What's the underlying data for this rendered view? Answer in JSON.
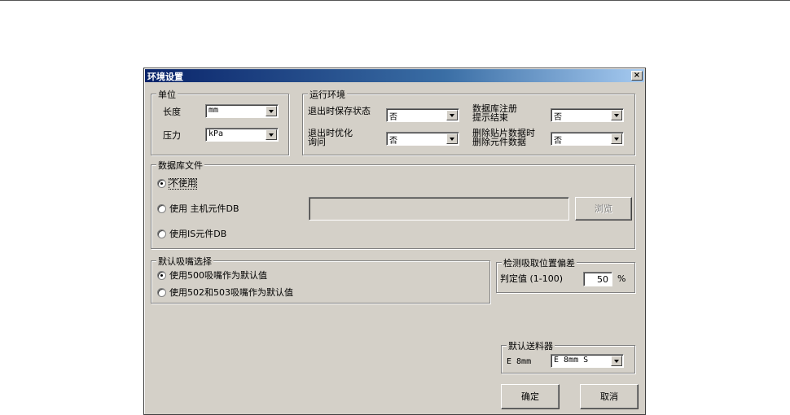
{
  "window": {
    "title": "环境设置",
    "close_glyph": "×"
  },
  "units": {
    "label": "单位",
    "length_label": "长度",
    "length_value": "mm",
    "pressure_label": "压力",
    "pressure_value": "kPa"
  },
  "runtime": {
    "label": "运行环境",
    "save_state_label": "退出时保存状态",
    "save_state_value": "否",
    "optimize_label_1": "退出时优化",
    "optimize_label_2": "询问",
    "optimize_value": "否",
    "db_register_label_1": "数据库注册",
    "db_register_label_2": "提示结束",
    "db_register_value": "否",
    "delete_label_1": "删除贴片数据时",
    "delete_label_2": "删除元件数据",
    "delete_value": "否"
  },
  "database": {
    "label": "数据库文件",
    "opt_none": "不使用",
    "opt_host": "使用 主机元件DB",
    "opt_is": "使用IS元件DB",
    "path_value": "",
    "browse_label": "浏览"
  },
  "nozzle": {
    "label": "默认吸嘴选择",
    "opt_500": "使用500吸嘴作为默认值",
    "opt_502": "使用502和503吸嘴作为默认值"
  },
  "pickup": {
    "label": "检测吸取位置偏差",
    "threshold_label": "判定值 (1-100)",
    "threshold_value": "50",
    "unit": "%"
  },
  "feeder": {
    "label": "默认送料器",
    "field_label": "E 8mm",
    "field_value": "E 8mm S"
  },
  "actions": {
    "ok_label": "确定",
    "cancel_label": "取消"
  }
}
